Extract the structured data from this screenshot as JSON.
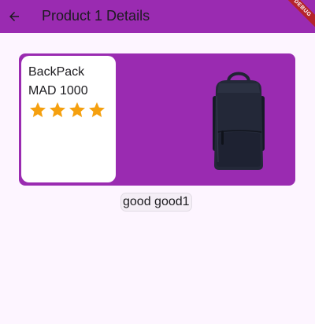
{
  "appbar": {
    "title": "Product 1 Details",
    "back_icon": "arrow-back-icon",
    "debug_banner": "DEBUG"
  },
  "product": {
    "name": "BackPack",
    "price": "MAD 1000",
    "rating": 4,
    "rating_max": 4,
    "star_icon": "star-icon",
    "image": "backpack-image"
  },
  "review": {
    "text": "good good1"
  },
  "colors": {
    "primary": "#9a2bb1",
    "star": "#f5a00f",
    "background": "#fdf5ff"
  }
}
